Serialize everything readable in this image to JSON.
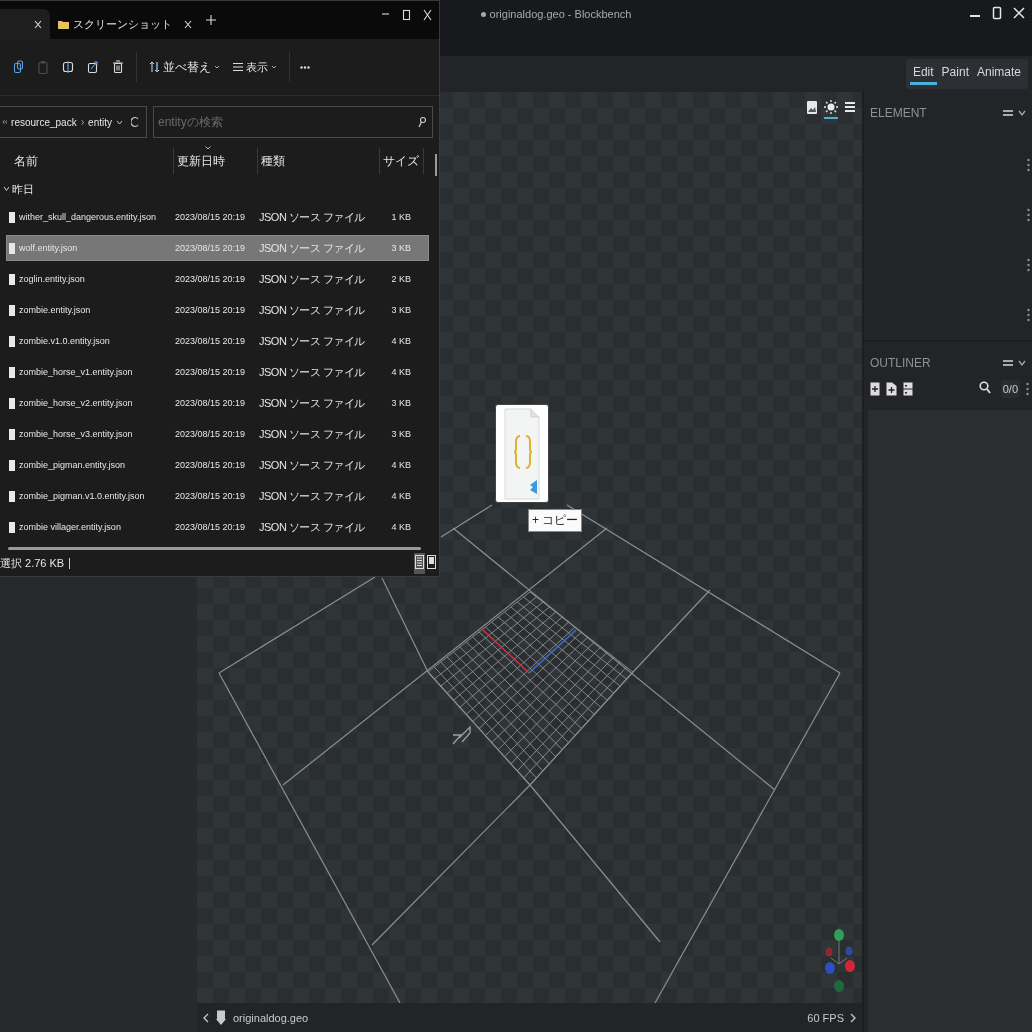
{
  "blockbench": {
    "window": {
      "title": "originaldog.geo - Blockbench",
      "unsaved": true
    },
    "modes": [
      {
        "label": "Edit",
        "selected": true
      },
      {
        "label": "Paint",
        "selected": false
      },
      {
        "label": "Animate",
        "selected": false
      }
    ],
    "viewport_tools": [
      {
        "kind": "image",
        "selected": false
      },
      {
        "kind": "sun",
        "selected": true
      },
      {
        "kind": "menu",
        "selected": false
      }
    ],
    "panels": [
      {
        "kind": "element",
        "title": "ELEMENT"
      },
      {
        "kind": "outliner",
        "title": "OUTLINER",
        "counter": "0/0"
      }
    ],
    "footer": {
      "file": "originaldog.geo",
      "fps": "60 FPS"
    }
  },
  "explorer": {
    "tabs": [
      {
        "selected": true
      },
      {
        "label": "スクリーンショット",
        "selected": false
      }
    ],
    "toolbar": [
      {
        "kind": "copy",
        "disabled": false
      },
      {
        "kind": "paste",
        "disabled": true
      },
      {
        "kind": "rename",
        "disabled": false
      },
      {
        "kind": "share",
        "disabled": false
      },
      {
        "kind": "delete",
        "disabled": false
      }
    ],
    "sort_label": "並べ替え",
    "view_label": "表示",
    "address": [
      "resource_pack",
      "entity"
    ],
    "search": {
      "placeholder": "entityの検索"
    },
    "columns": [
      {
        "label": "名前",
        "sorted": false
      },
      {
        "label": "更新日時",
        "sorted": true
      },
      {
        "label": "種類",
        "sorted": false
      },
      {
        "label": "サイズ",
        "sorted": false
      }
    ],
    "group": {
      "label": "昨日",
      "expanded": true
    },
    "rows": [
      {
        "name": "wither_skull_dangerous.entity.json",
        "date": "2023/08/15 20:19",
        "type": "JSON ソース ファイル",
        "size": "1 KB",
        "selected": false
      },
      {
        "name": "wolf.entity.json",
        "date": "2023/08/15 20:19",
        "type": "JSON ソース ファイル",
        "size": "3 KB",
        "selected": true
      },
      {
        "name": "zoglin.entity.json",
        "date": "2023/08/15 20:19",
        "type": "JSON ソース ファイル",
        "size": "2 KB",
        "selected": false
      },
      {
        "name": "zombie.entity.json",
        "date": "2023/08/15 20:19",
        "type": "JSON ソース ファイル",
        "size": "3 KB",
        "selected": false
      },
      {
        "name": "zombie.v1.0.entity.json",
        "date": "2023/08/15 20:19",
        "type": "JSON ソース ファイル",
        "size": "4 KB",
        "selected": false
      },
      {
        "name": "zombie_horse_v1.entity.json",
        "date": "2023/08/15 20:19",
        "type": "JSON ソース ファイル",
        "size": "4 KB",
        "selected": false
      },
      {
        "name": "zombie_horse_v2.entity.json",
        "date": "2023/08/15 20:19",
        "type": "JSON ソース ファイル",
        "size": "3 KB",
        "selected": false
      },
      {
        "name": "zombie_horse_v3.entity.json",
        "date": "2023/08/15 20:19",
        "type": "JSON ソース ファイル",
        "size": "3 KB",
        "selected": false
      },
      {
        "name": "zombie_pigman.entity.json",
        "date": "2023/08/15 20:19",
        "type": "JSON ソース ファイル",
        "size": "4 KB",
        "selected": false
      },
      {
        "name": "zombie_pigman.v1.0.entity.json",
        "date": "2023/08/15 20:19",
        "type": "JSON ソース ファイル",
        "size": "4 KB",
        "selected": false
      },
      {
        "name": "zombie villager.entity.json",
        "date": "2023/08/15 20:19",
        "type": "JSON ソース ファイル",
        "size": "4 KB",
        "selected": false
      }
    ],
    "status": "選択 2.76 KB",
    "view_modes": [
      {
        "kind": "details",
        "selected": true
      },
      {
        "kind": "tiles",
        "selected": false
      }
    ]
  },
  "drag": {
    "kind": "json-file",
    "action": "+ コピー"
  }
}
